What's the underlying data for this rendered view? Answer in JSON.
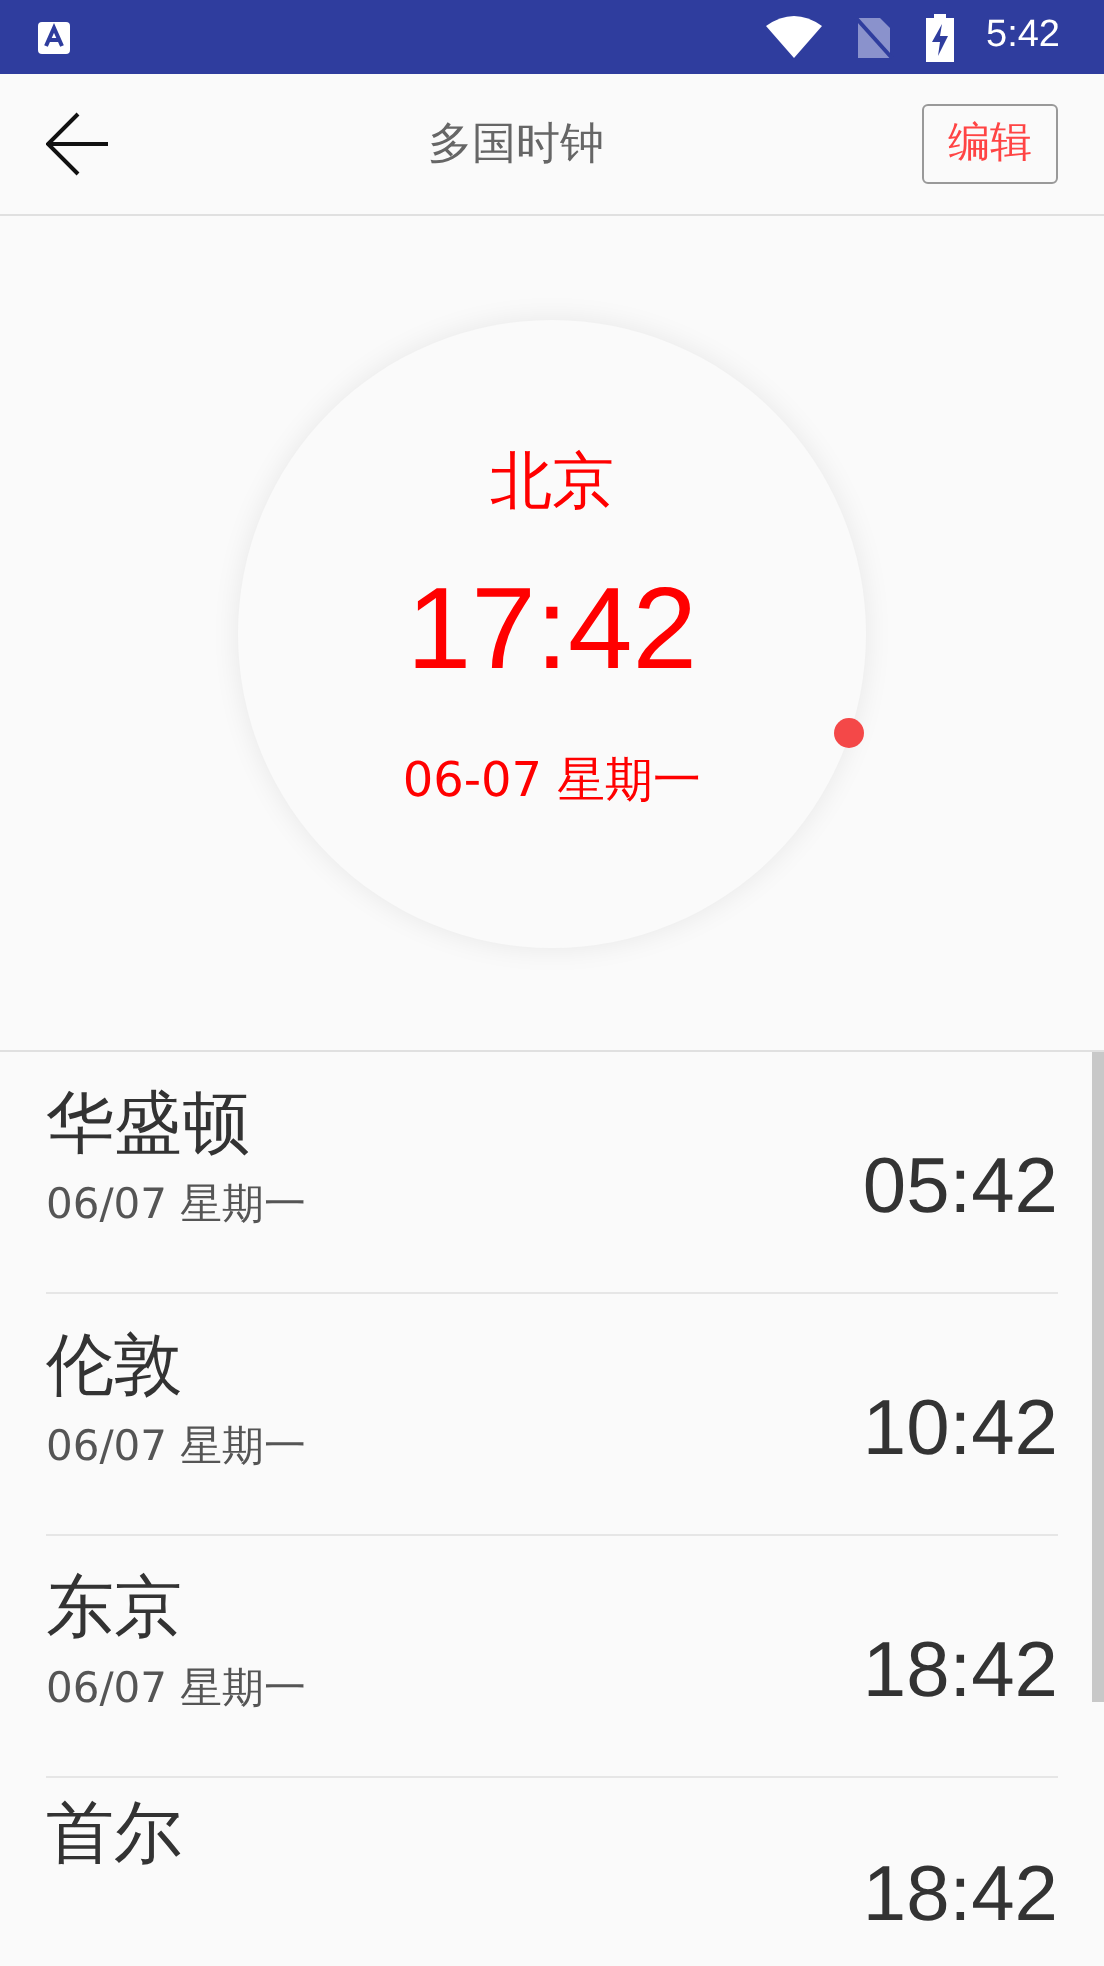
{
  "status_bar": {
    "time": "5:42"
  },
  "toolbar": {
    "title": "多国时钟",
    "edit_button": "编辑"
  },
  "main_clock": {
    "city": "北京",
    "time": "17:42",
    "date": "06-07 星期一"
  },
  "cities": [
    {
      "name": "华盛顿",
      "date": "06/07 星期一",
      "time": "05:42"
    },
    {
      "name": "伦敦",
      "date": "06/07 星期一",
      "time": "10:42"
    },
    {
      "name": "东京",
      "date": "06/07 星期一",
      "time": "18:42"
    },
    {
      "name": "首尔",
      "time": "18:42"
    }
  ]
}
